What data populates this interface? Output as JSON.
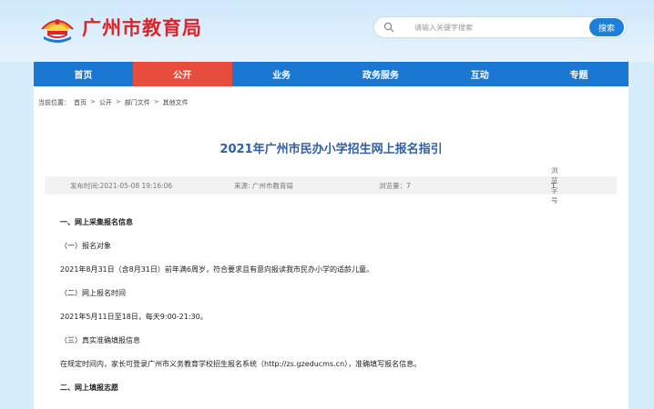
{
  "header": {
    "site_name": "广州市教育局",
    "logo_icon": "education-emblem-icon",
    "search": {
      "placeholder": "请输入关键字搜索",
      "button_label": "搜索",
      "icon": "search-icon"
    }
  },
  "nav": {
    "items": [
      {
        "label": "首页"
      },
      {
        "label": "公开"
      },
      {
        "label": "业务"
      },
      {
        "label": "政务服务"
      },
      {
        "label": "互动"
      },
      {
        "label": "专题"
      }
    ],
    "active_index": 1,
    "colors": {
      "bar": "#1a77d2",
      "active": "#e84c3d"
    }
  },
  "breadcrumb": {
    "prefix": "当前位置：",
    "items": [
      "首页",
      "公开",
      "部门文件",
      "其他文件"
    ],
    "separator": ">"
  },
  "article": {
    "title": "2021年广州市民办小学招生网上报名指引",
    "meta": {
      "published": "发布时间:2021-05-08 19:16:06",
      "source": "来源: 广州市教育局",
      "views": "浏览量：7",
      "font_size_label": "浏览字号",
      "font_icon": "text-size-icon"
    },
    "paragraphs": [
      {
        "text": "一、网上采集报名信息",
        "bold": true
      },
      {
        "text": "（一）报名对象",
        "bold": false
      },
      {
        "text": "2021年8月31日（含8月31日）前年满6周岁，符合要求且有意向报读我市民办小学的适龄儿童。",
        "bold": false
      },
      {
        "text": "（二）网上报名时间",
        "bold": false
      },
      {
        "text": "2021年5月11日至18日，每天9:00-21:30。",
        "bold": false
      },
      {
        "text": "（三）真实准确填报信息",
        "bold": false
      },
      {
        "text": "在规定时间内，家长可登录广州市义务教育学校招生报名系统（http://zs.gzeducms.cn），准确填写报名信息。",
        "bold": false
      },
      {
        "text": "二、网上填报志愿",
        "bold": true
      }
    ]
  }
}
